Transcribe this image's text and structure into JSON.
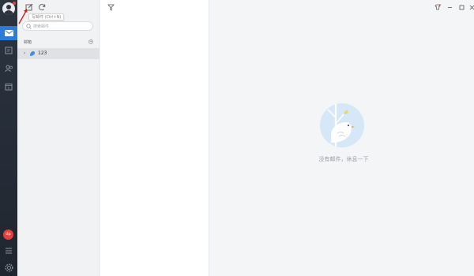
{
  "rail": {
    "app_badge": "dp"
  },
  "toolbar": {
    "tooltip": "写邮件 (Ctrl+N)"
  },
  "search": {
    "placeholder": "搜索邮件"
  },
  "folders": {
    "section_label": "邮箱",
    "add_label": "+",
    "account_name": "123"
  },
  "reader": {
    "empty_text": "没有邮件，休息一下"
  },
  "colors": {
    "rail": "#2c3440",
    "active": "#2b7bd9",
    "badge": "#e2413b",
    "annotation": "#d0201b"
  }
}
